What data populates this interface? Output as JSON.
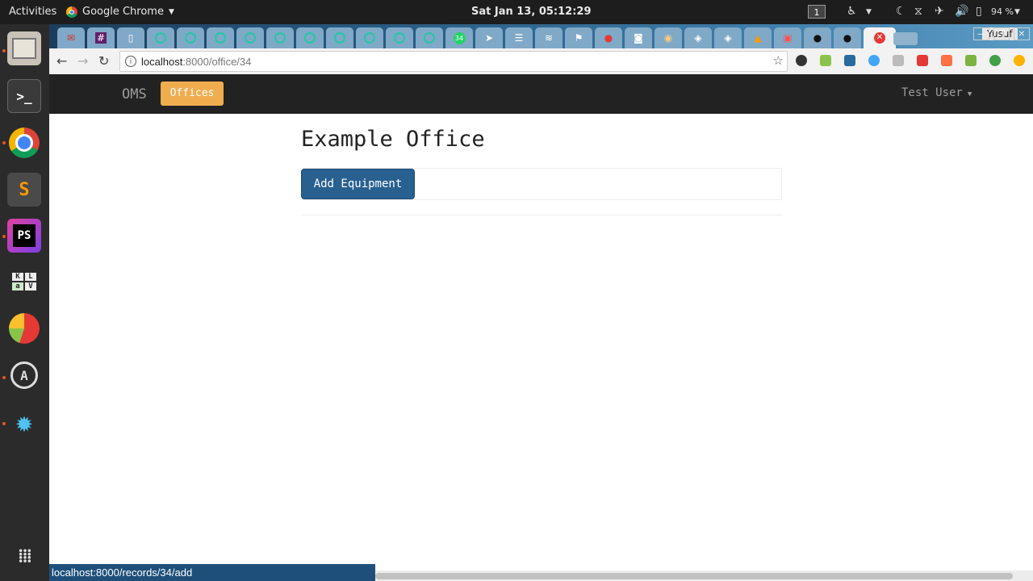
{
  "topbar": {
    "activities": "Activities",
    "app_name": "Google Chrome",
    "clock": "Sat Jan 13, 05:12:29",
    "workspace": "1",
    "battery": "94 %"
  },
  "browser": {
    "profile": "Yusuf",
    "tab_badge": "34",
    "url_host": "localhost",
    "url_rest": ":8000/office/34",
    "status_url": "localhost:8000/records/34/add"
  },
  "navbar": {
    "brand": "OMS",
    "offices": "Offices",
    "user": "Test User"
  },
  "page": {
    "title": "Example Office",
    "add_equipment": "Add Equipment"
  },
  "colors": {
    "navbar_bg": "#222222",
    "offices_active": "#f0ad4e",
    "primary_button": "#286090",
    "status_bubble": "#1e4f7a"
  }
}
